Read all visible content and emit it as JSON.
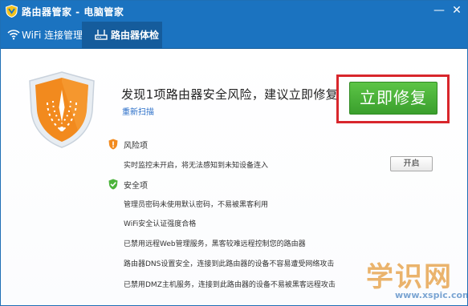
{
  "window": {
    "title": "路由器管家 - 电脑管家",
    "minimize_glyph": "—",
    "close_glyph": "✕"
  },
  "tabs": [
    {
      "label": "WiFi 连接管理",
      "icon": "wifi-icon",
      "active": false
    },
    {
      "label": "路由器体检",
      "icon": "router-icon",
      "active": true
    }
  ],
  "scan_result": {
    "headline": "发现1项路由器安全风险，建议立即修复",
    "rescan_label": "重新扫描",
    "fix_button_label": "立即修复"
  },
  "risk_section": {
    "title": "风险项",
    "icon": "warning-shield-icon",
    "items": [
      {
        "text": "实时监控未开启，将无法感知到未知设备连入",
        "action_label": "开启"
      }
    ]
  },
  "safe_section": {
    "title": "安全项",
    "icon": "check-shield-icon",
    "items": [
      "管理员密码未使用默认密码，不易被黑客利用",
      "WiFi安全认证强度合格",
      "已禁用远程Web管理服务，黑客较难远程控制您的路由器",
      "路由器DNS设置安全，连接到此路由器的设备不容易遭受网络攻击",
      "已禁用DMZ主机服务，连接到此路由器的设备不易被黑客远程攻击"
    ]
  },
  "watermark": {
    "text": "学识网",
    "url": "www.xspic.com"
  },
  "colors": {
    "titlebar": "#1b73c0",
    "active_tab": "#155c9c",
    "shield_orange": "#f28a1e",
    "fix_green": "#4bb33a",
    "highlight_red": "#d8262c",
    "link_blue": "#2a6ec8"
  }
}
